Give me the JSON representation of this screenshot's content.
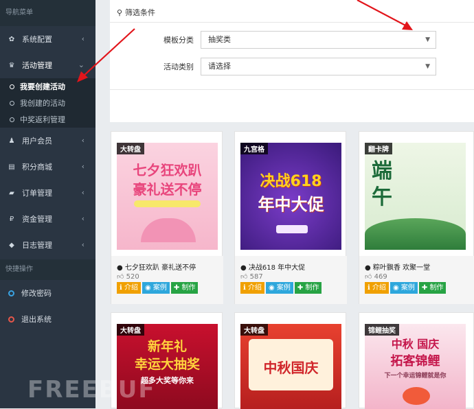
{
  "sidebar": {
    "nav_header": "导航菜单",
    "items": [
      {
        "label": "系统配置",
        "icon": "gear-icon",
        "glyph": "✿"
      },
      {
        "label": "活动管理",
        "icon": "trophy-icon",
        "glyph": "♛"
      }
    ],
    "sub_items": [
      {
        "label": "我要创建活动"
      },
      {
        "label": "我创建的活动"
      },
      {
        "label": "中奖返利管理"
      }
    ],
    "items2": [
      {
        "label": "用户会员",
        "icon": "users-icon",
        "glyph": "♟"
      },
      {
        "label": "积分商城",
        "icon": "cart-icon",
        "glyph": "▤"
      },
      {
        "label": "订单管理",
        "icon": "truck-icon",
        "glyph": "▰"
      },
      {
        "label": "资金管理",
        "icon": "paypal-icon",
        "glyph": "₽"
      },
      {
        "label": "日志管理",
        "icon": "shield-icon",
        "glyph": "◆"
      }
    ],
    "quick_header": "快捷操作",
    "quick": [
      {
        "label": "修改密码",
        "color": "#3aa3e3"
      },
      {
        "label": "退出系统",
        "color": "#e8574a"
      }
    ]
  },
  "filter": {
    "title": "筛选条件",
    "template_label": "模板分类",
    "template_value": "抽奖类",
    "activity_label": "活动类别",
    "activity_value": "请选择"
  },
  "cards": [
    {
      "tag": "大转盘",
      "line1": "七夕狂欢趴",
      "line2": "豪礼送不停",
      "title": "● 七夕狂欢趴 豪礼送不停",
      "likes": "520"
    },
    {
      "tag": "九宫格",
      "line1": "决战618",
      "line2": "年中大促",
      "title": "● 决战618 年中大促",
      "likes": "587"
    },
    {
      "tag": "翻卡牌",
      "line1": "端",
      "line2": "午",
      "title": "● 粽叶飘香 欢聚一堂",
      "likes": "469"
    },
    {
      "tag": "大转盘",
      "line1": "新年礼",
      "line2": "幸运大抽奖",
      "line3": "超多大奖等你来"
    },
    {
      "tag": "大转盘",
      "line1": "中秋国庆"
    },
    {
      "tag": "锦鲤抽奖",
      "line1": "中秋 国庆",
      "line2": "拓客锦鲤",
      "line3": "下一个幸运锦鲤就是你"
    }
  ],
  "buttons": {
    "intro": "介绍",
    "case": "案例",
    "make": "制作"
  },
  "watermark": "FREEBUF"
}
